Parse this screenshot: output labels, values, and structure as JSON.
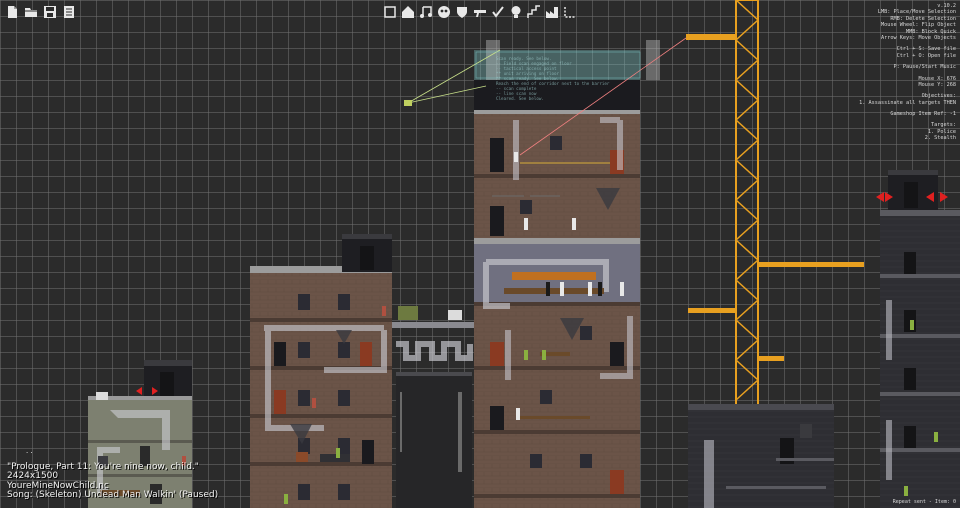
{
  "left_toolbar": [
    {
      "name": "new-file-icon",
      "title": ""
    },
    {
      "name": "open-folder-icon",
      "title": ""
    },
    {
      "name": "save-icon",
      "title": ""
    },
    {
      "name": "list-icon",
      "title": ""
    }
  ],
  "center_toolbar": [
    {
      "name": "square-tool-icon"
    },
    {
      "name": "house-tool-icon"
    },
    {
      "name": "music-note-tool-icon"
    },
    {
      "name": "panda-tool-icon"
    },
    {
      "name": "shield-tool-icon"
    },
    {
      "name": "gun-tool-icon"
    },
    {
      "name": "checkmark-tool-icon"
    },
    {
      "name": "lightbulb-tool-icon"
    },
    {
      "name": "stairs-tool-icon"
    },
    {
      "name": "factory-tool-icon"
    },
    {
      "name": "corner-select-tool-icon"
    }
  ],
  "help_lines": [
    "v.10.2",
    "LMB: Place/Move Selection",
    "RMB: Delete Selection",
    "Mouse Wheel: Flip Object",
    "MMB: Block Quick",
    "Arrow Keys: Move Objects",
    "",
    "Ctrl + S: Save file",
    "Ctrl + O: Open file",
    "",
    "P: Pause/Start Music",
    "",
    "Mouse X: 676",
    "Mouse Y: 268",
    "",
    "Objectives:",
    "1. Assassinate all targets THEN",
    "",
    "Gameshop Item Ref: -1",
    "",
    "Targets:",
    "1. Police",
    "2. Stealth"
  ],
  "terminal_lines": [
    "Scan ready. See below.",
    "-- Field scan engaged on floor",
    "-- tactical access point",
    "** unit arriving on floor",
    "** scan ready. See below.",
    "Reach the end of corridor next to the barrier",
    "-- scan complete",
    "-- line scan now",
    "Cleared. See below."
  ],
  "level_info": {
    "title": "\"Prologue, Part 11: You're nine now, child.\"",
    "size": "2424x1500",
    "file": "YoureMineNowChild.nc",
    "song": "Song: (Skeleton) Undead Man Walkin' (Paused)"
  },
  "status_text": "Repeat sent - Item: 0",
  "zz_mark": ". ."
}
